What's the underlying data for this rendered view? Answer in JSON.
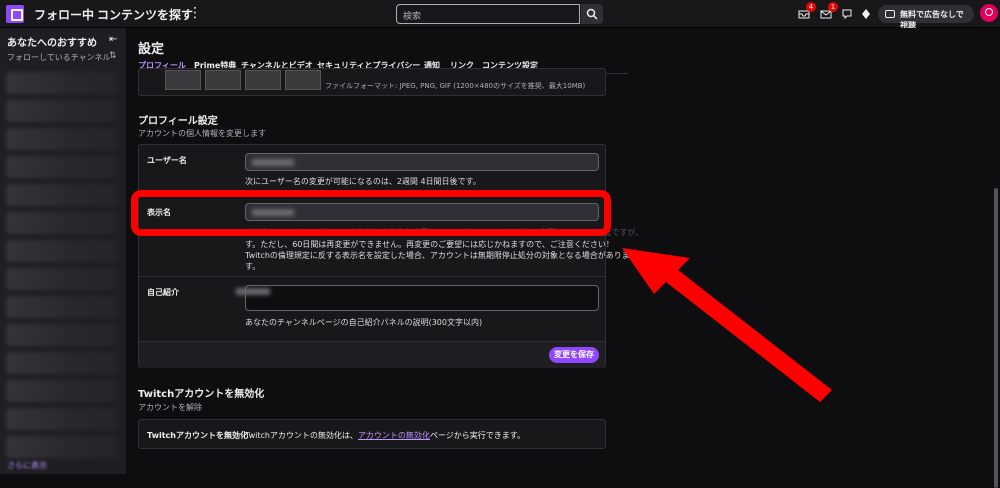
{
  "topbar": {
    "following": "フォロー中",
    "browse": "コンテンツを探す",
    "more": "⋮",
    "search_placeholder": "検索",
    "inbox_badge": "4",
    "whispers_badge": "1",
    "ad_free": "無料で広告なしで視聴"
  },
  "sidebar": {
    "title": "あなたへのおすすめ",
    "subtitle": "フォローしているチャンネル",
    "show_more": "さらに表示"
  },
  "page": {
    "title": "設定",
    "tabs": [
      "プロフィール",
      "Prime特典",
      "チャンネルとビデオ",
      "セキュリティとプライバシー",
      "通知",
      "リンク",
      "コンテンツ設定"
    ],
    "image_hint": "ファイルフォーマット: JPEG, PNG, GIF (1200×480のサイズを推奨、最大10MB)"
  },
  "profile": {
    "title": "プロフィール設定",
    "subtitle": "アカウントの個人情報を変更します",
    "username_label": "ユーザー名",
    "username_hint": "次にユーザー名の変更が可能になるのは、2週間 4日間日後です。",
    "display_label": "表示名",
    "display_hint1": "表示名をカスタマイズして、大文字と小文字を変更することができます。表示名の変更はいつでも可能ですが、",
    "display_hint2": "す。ただし、60日間は再変更ができません。再変更のご要望には応じかねますので、ご注意ください！",
    "display_hint3": "Twitchの倫理規定に反する表示名を設定した場合、アカウントは無期限停止処分の対象となる場合がありま",
    "display_hint4": "す。",
    "bio_label": "自己紹介",
    "bio_hint": "あなたのチャンネルページの自己紹介パネルの説明(300文字以内)",
    "save": "変更を保存"
  },
  "disable": {
    "title": "Twitchアカウントを無効化",
    "subtitle": "アカウントを解除",
    "label": "Twitchアカウントを無効化",
    "text_before": "Twitchアカウントの無効化は、",
    "link": "アカウントの無効化",
    "text_after": "ページから実行できます。"
  },
  "colors": {
    "accent": "#9147ff",
    "highlight": "#ff0000"
  }
}
